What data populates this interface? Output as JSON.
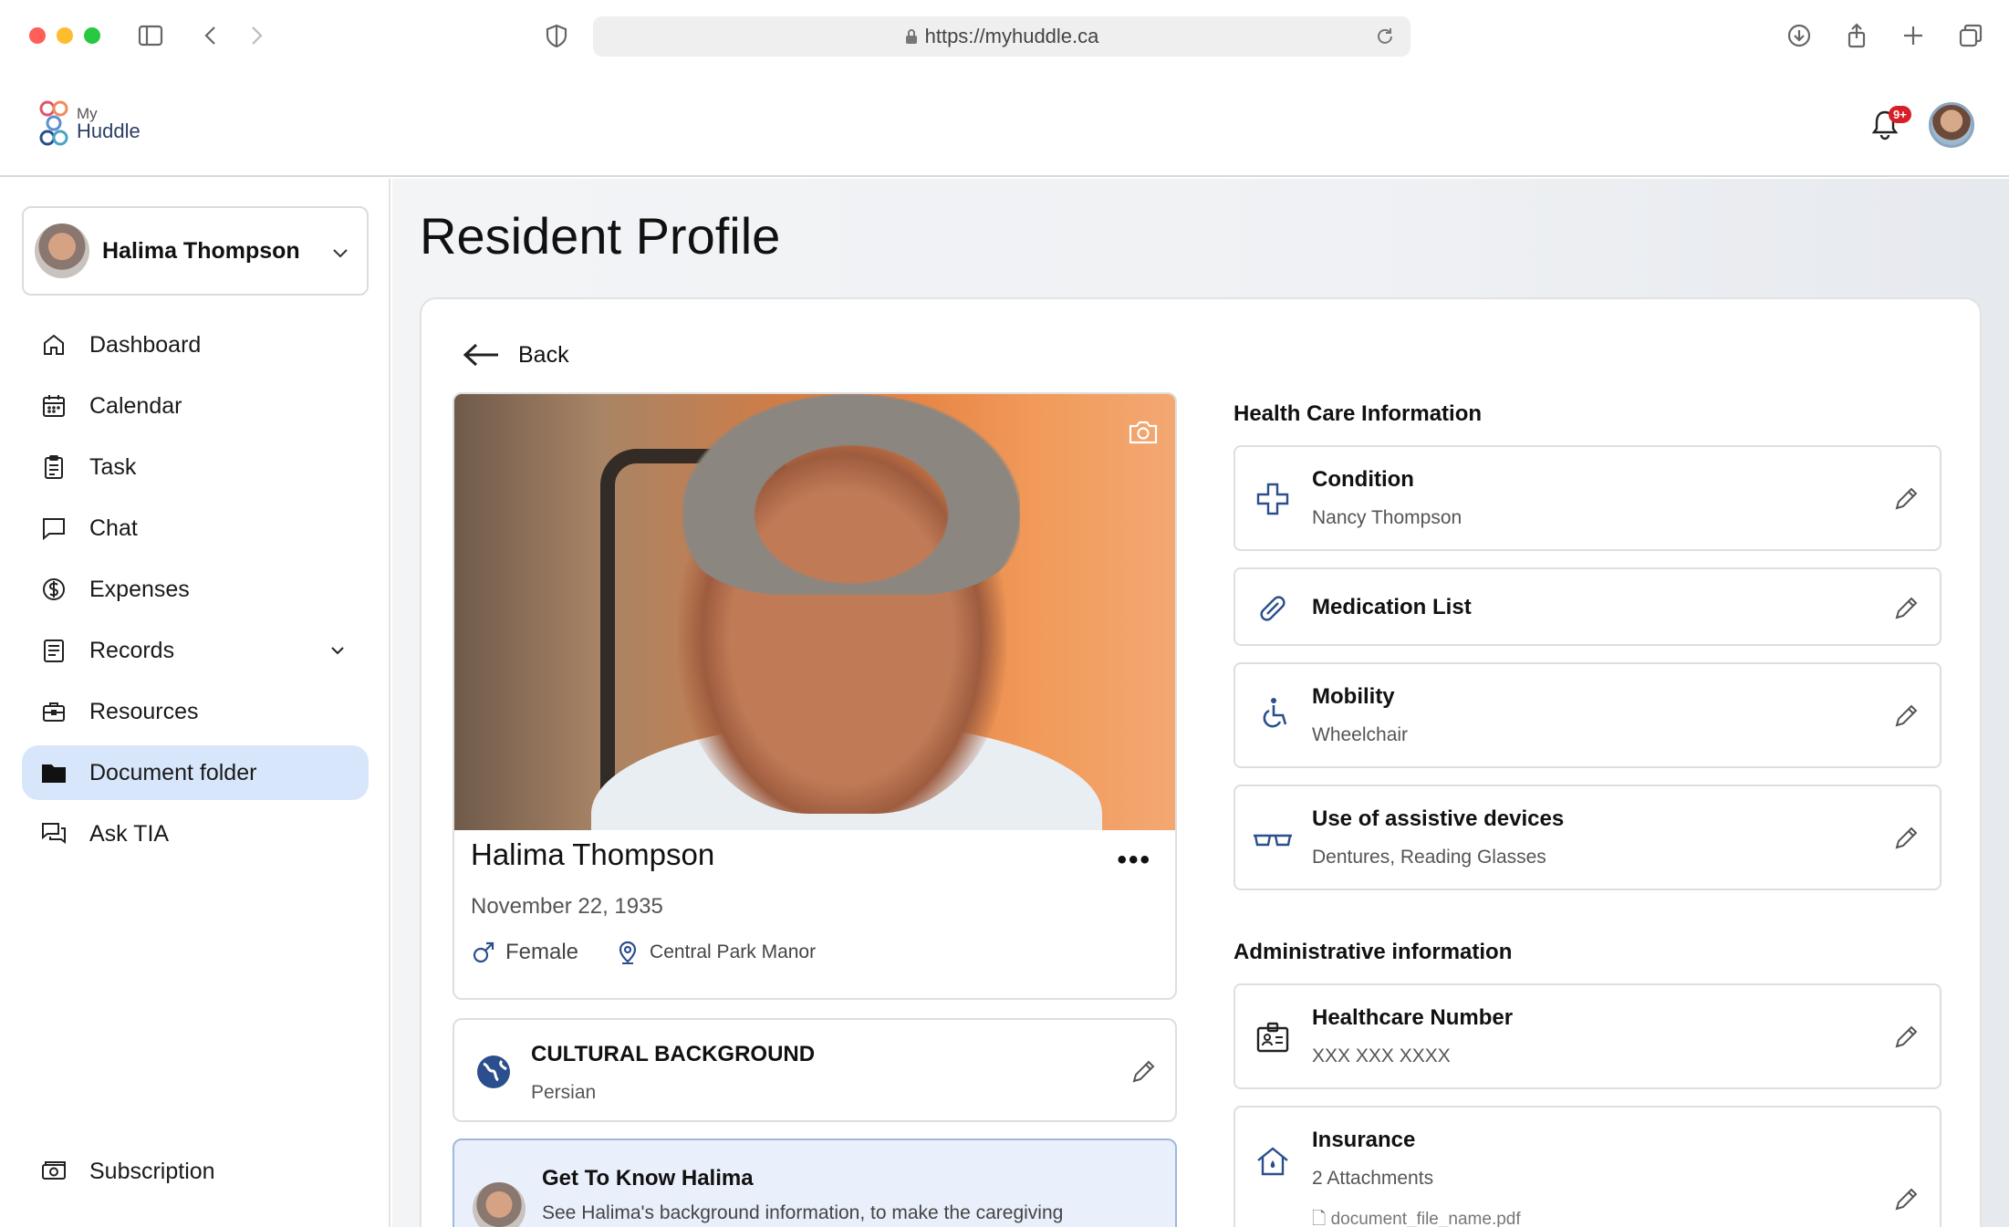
{
  "browser": {
    "url": "https://myhuddle.ca"
  },
  "app": {
    "logo_my": "My",
    "logo_huddle": "Huddle",
    "notification_badge": "9+"
  },
  "sidebar": {
    "resident_name": "Halima Thompson",
    "items": [
      {
        "label": "Dashboard",
        "icon": "home-icon"
      },
      {
        "label": "Calendar",
        "icon": "calendar-icon"
      },
      {
        "label": "Task",
        "icon": "clipboard-icon"
      },
      {
        "label": "Chat",
        "icon": "chat-icon"
      },
      {
        "label": "Expenses",
        "icon": "dollar-icon"
      },
      {
        "label": "Records",
        "icon": "document-icon"
      },
      {
        "label": "Resources",
        "icon": "briefcase-icon"
      },
      {
        "label": "Document folder",
        "icon": "folder-icon"
      },
      {
        "label": "Ask TIA",
        "icon": "ask-chat-icon"
      }
    ],
    "active_item": "Document folder",
    "bottom_items": [
      {
        "label": "Subscription",
        "icon": "money-icon"
      }
    ]
  },
  "main": {
    "page_title": "Resident Profile",
    "back_label": "Back",
    "profile": {
      "name": "Halima Thompson",
      "dob": "November 22, 1935",
      "gender": "Female",
      "location": "Central Park Manor"
    },
    "cultural": {
      "title": "CULTURAL BACKGROUND",
      "value": "Persian"
    },
    "know": {
      "title": "Get To Know Halima",
      "desc": "See Halima's background information, to make the caregiving"
    },
    "health": {
      "section_title": "Health Care Information",
      "cards": [
        {
          "title": "Condition",
          "value": "Nancy Thompson",
          "icon": "medical-cross-icon"
        },
        {
          "title": "Medication List",
          "value": "",
          "icon": "pill-icon"
        },
        {
          "title": "Mobility",
          "value": "Wheelchair",
          "icon": "wheelchair-icon"
        },
        {
          "title": "Use of assistive devices",
          "value": "Dentures, Reading Glasses",
          "icon": "glasses-icon"
        }
      ]
    },
    "admin": {
      "section_title": "Administrative information",
      "cards": [
        {
          "title": "Healthcare Number",
          "value": "XXX XXX XXXX",
          "icon": "id-card-icon"
        },
        {
          "title": "Insurance",
          "value": "2 Attachments",
          "icon": "house-icon",
          "file": "document_file_name.pdf"
        }
      ]
    }
  }
}
